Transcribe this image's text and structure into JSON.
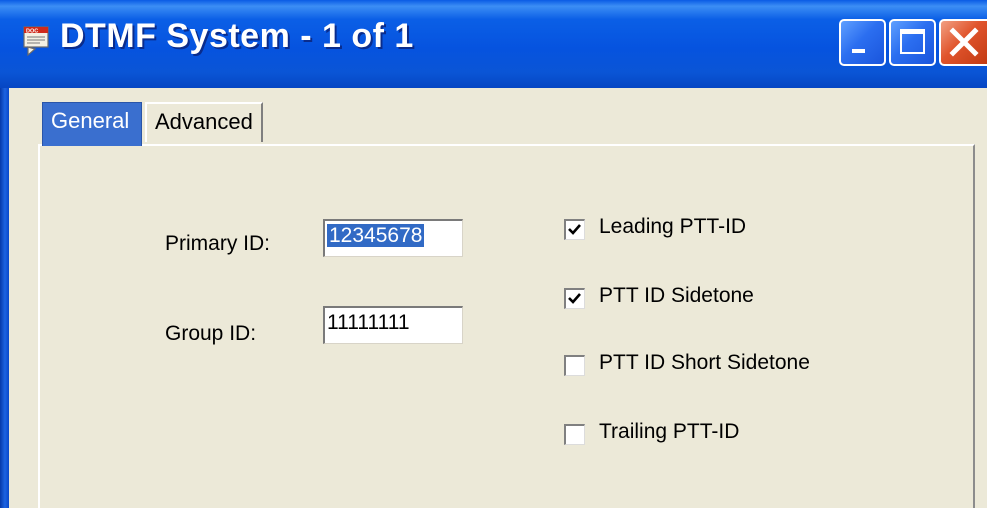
{
  "window": {
    "title": "DTMF System - 1 of 1",
    "app_icon": "doc-window-icon",
    "controls": {
      "minimize": "minimize-icon",
      "maximize": "maximize-icon",
      "close": "close-icon"
    }
  },
  "tabs": [
    {
      "label": "General",
      "active": true
    },
    {
      "label": "Advanced",
      "active": false
    }
  ],
  "form": {
    "primary_id": {
      "label": "Primary ID:",
      "value": "12345678",
      "selected": true
    },
    "group_id": {
      "label": "Group ID:",
      "value": "11111111"
    }
  },
  "options": [
    {
      "label": "Leading PTT-ID",
      "checked": true
    },
    {
      "label": "PTT ID Sidetone",
      "checked": true
    },
    {
      "label": "PTT ID Short Sidetone",
      "checked": false
    },
    {
      "label": "Trailing PTT-ID",
      "checked": false
    }
  ],
  "colors": {
    "titlebar": "#0a55d6",
    "active_tab": "#3a6fcf",
    "selection": "#316ac5",
    "close_button": "#e0542c",
    "face": "#ece9d8"
  }
}
